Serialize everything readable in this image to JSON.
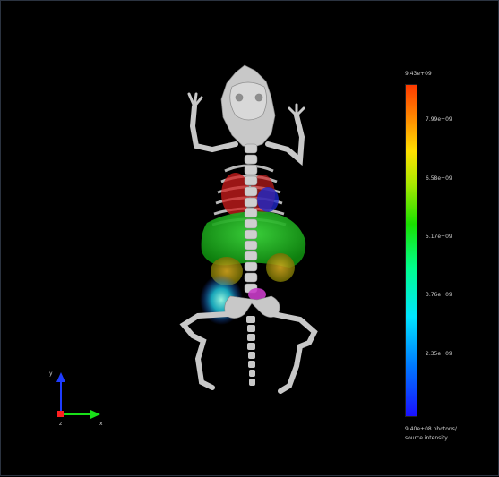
{
  "colorbar": {
    "max_label": "9.43e+09",
    "ticks": [
      {
        "label": "7.99e+09",
        "value": 7.99
      },
      {
        "label": "6.58e+09",
        "value": 6.58
      },
      {
        "label": "5.17e+09",
        "value": 5.17
      },
      {
        "label": "3.76e+09",
        "value": 3.76
      },
      {
        "label": "2.35e+09",
        "value": 2.35
      }
    ],
    "min_value": 0.94,
    "max_value": 9.43,
    "bottom_label_line1": "9.40e+08 photons/",
    "bottom_label_line2": "source intensity"
  },
  "axes": {
    "y_label": "y",
    "x_label": "x",
    "z_label": "z",
    "y_color": "#1e3cff",
    "x_color": "#19e019",
    "z_color": "#ff2020"
  },
  "scene": {
    "bone_color": "#c8c8c8",
    "lung_color": "#d01e1e",
    "heart_color": "#1e28c8",
    "liver_color": "#1fbf1f",
    "kidney_color": "#c89a00",
    "bladder_color": "#c83cc8",
    "hotspot_color": "#1ecfe6"
  }
}
